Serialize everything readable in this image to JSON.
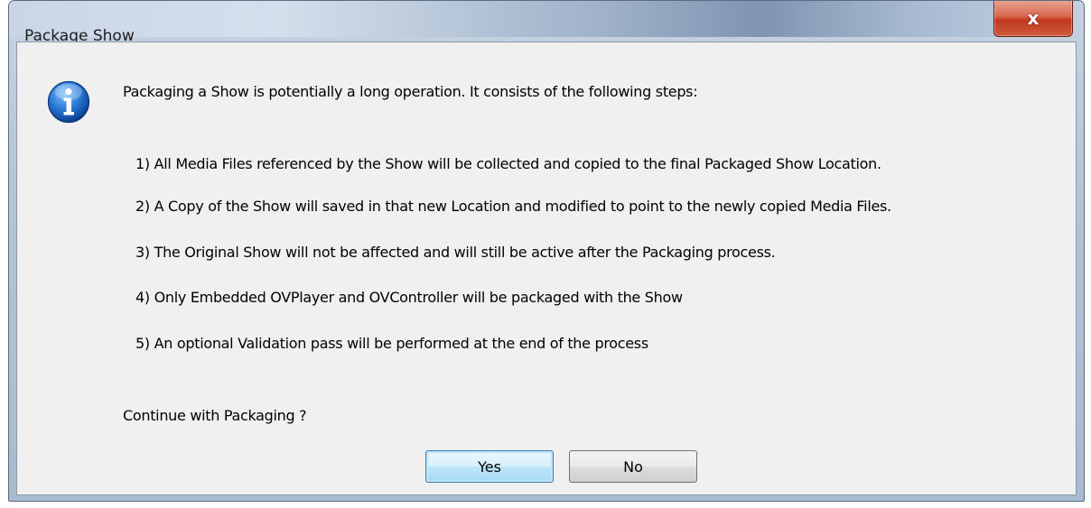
{
  "window": {
    "title": "Package Show",
    "close_label": "x"
  },
  "dialog": {
    "icon": "info-icon",
    "intro": "Packaging a Show is potentially a long operation. It consists of the following steps:",
    "steps": [
      "1) All Media Files referenced by the Show will be collected and copied to the final Packaged Show Location.",
      "2) A Copy of the Show will saved in that new Location and modified to point to the newly copied Media Files.",
      "3) The Original Show will not be affected and will still be active after the Packaging process.",
      "4) Only Embedded OVPlayer and OVController will be packaged with the Show",
      "5) An optional Validation pass will be performed at the end of the process"
    ],
    "question": "Continue with Packaging ?"
  },
  "buttons": {
    "yes": "Yes",
    "no": "No"
  },
  "colors": {
    "client_bg": "#f0f0f0",
    "close_red": "#c1391f",
    "default_button_border": "#3c7fb1"
  }
}
